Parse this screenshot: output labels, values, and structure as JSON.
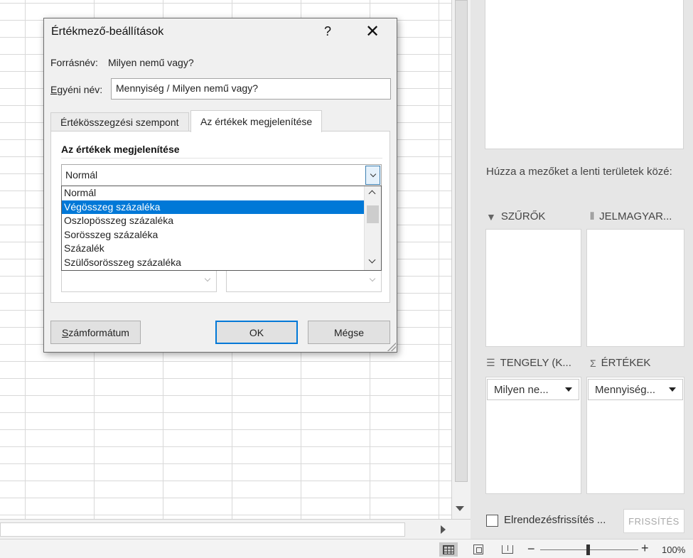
{
  "dialog": {
    "title": "Értékmező-beállítások",
    "help": "?",
    "close": "✕",
    "source_label": "Forrásnév:",
    "source_value": "Milyen nemű vagy?",
    "custom_label_first": "E",
    "custom_label_rest": "gyéni név:",
    "custom_value": "Mennyiség / Milyen nemű vagy?",
    "tabs": [
      {
        "label": "Értékösszegzési szempont"
      },
      {
        "label": "Az értékek megjelenítése"
      }
    ],
    "section_title": "Az értékek megjelenítése",
    "combo_value": "Normál",
    "options": [
      "Normál",
      "Végösszeg százaléka",
      "Oszlopösszeg százaléka",
      "Sorösszeg százaléka",
      "Százalék",
      "Szülősorösszeg százaléka"
    ],
    "selected_option": "Végösszeg százaléka",
    "number_format_first": "S",
    "number_format_rest": "zámformátum",
    "ok": "OK",
    "cancel": "Mégse"
  },
  "pane": {
    "hint": "Húzza a mezőket a lenti területek közé:",
    "filters": "SZŰRŐK",
    "legend": "JELMAGYAR...",
    "axis": "TENGELY (K...",
    "values": "ÉRTÉKEK",
    "axis_field": "Milyen ne...",
    "values_field": "Mennyiség...",
    "defer_label": "Elrendezésfrissítés ...",
    "refresh": "FRISSÍTÉS"
  },
  "statusbar": {
    "zoom_minus": "−",
    "zoom_plus": "+",
    "zoom": "100%"
  },
  "colors": {
    "selection": "#0078d7",
    "pane_bg": "#e6e6e6",
    "dialog_bg": "#f0f0f0"
  }
}
